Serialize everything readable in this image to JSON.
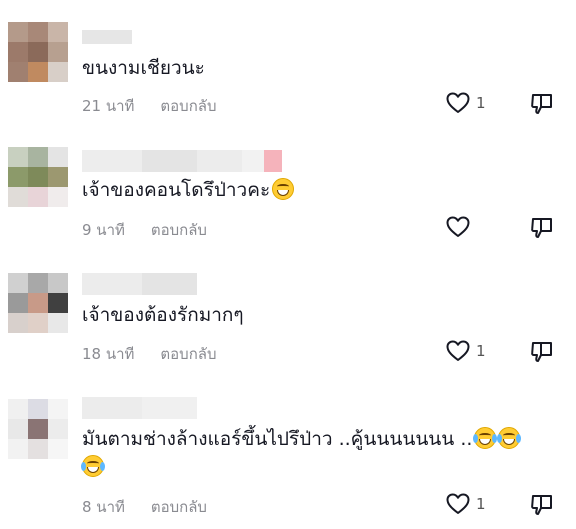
{
  "comments": [
    {
      "text": "ขนงามเชียวนะ",
      "time": "21 นาที",
      "reply_label": "ตอบกลับ",
      "likes": "1",
      "emoji": ""
    },
    {
      "text": "เจ้าของคอนโดรึป่าวคะ",
      "time": "9 นาที",
      "reply_label": "ตอบกลับ",
      "likes": "",
      "emoji": "grinning-face"
    },
    {
      "text": "เจ้าของต้องรักมากๆ",
      "time": "18 นาที",
      "reply_label": "ตอบกลับ",
      "likes": "1",
      "emoji": ""
    },
    {
      "text": "มันตามช่างล้างแอร์ขึ้นไปรึป่าว ..คู้นนนนนนน ..",
      "time": "8 นาที",
      "reply_label": "ตอบกลับ",
      "likes": "1",
      "emoji": "face-with-tears-of-joy"
    }
  ],
  "icons": {
    "like": "heart-outline-icon",
    "dislike": "thumbs-down-outline-icon"
  },
  "colors": {
    "text": "#161823",
    "meta": "#8a8b91",
    "icon": "#161823"
  }
}
